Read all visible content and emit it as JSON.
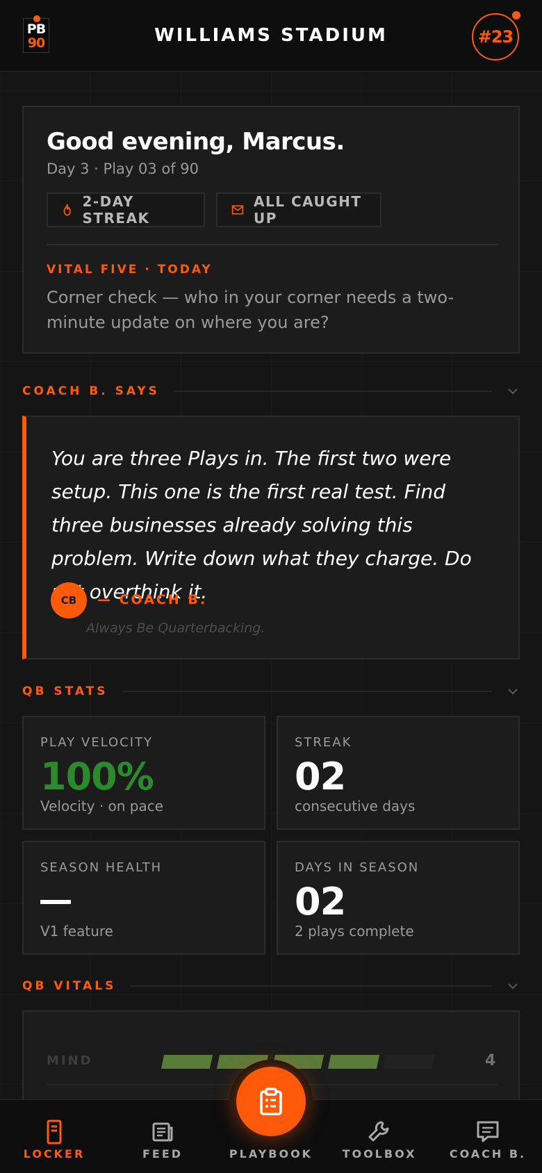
{
  "header": {
    "logo_top": "PB",
    "logo_bottom": "90",
    "title": "WILLIAMS STADIUM",
    "jersey": "#23"
  },
  "greeting": {
    "title": "Good evening, Marcus.",
    "subtitle": "Day 3 · Play 03 of 90",
    "chips": [
      {
        "icon": "flame-icon",
        "label": "2-DAY STREAK"
      },
      {
        "icon": "mail-icon",
        "label": "ALL CAUGHT UP"
      }
    ],
    "vital_label": "VITAL FIVE · TODAY",
    "vital_text": "Corner check — who in your corner needs a two-minute update on where you are?"
  },
  "coach": {
    "section_title": "COACH B. SAYS",
    "quote": "You are three Plays in. The first two were setup. This one is the first real test. Find three businesses already solving this problem. Write down what they charge. Do not overthink it.",
    "avatar_initials": "CB",
    "signature": "— COACH B.",
    "motto": "Always Be Quarterbacking."
  },
  "stats": {
    "section_title": "QB STATS",
    "items": [
      {
        "label": "PLAY VELOCITY",
        "value": "100%",
        "sub": "Velocity · on pace"
      },
      {
        "label": "STREAK",
        "value": "02",
        "sub": "consecutive days"
      },
      {
        "label": "SEASON HEALTH",
        "value": "—",
        "sub": "V1 feature"
      },
      {
        "label": "DAYS IN SEASON",
        "value": "02",
        "sub": "2 plays complete"
      }
    ]
  },
  "vitals": {
    "section_title": "QB VITALS",
    "rows": [
      {
        "label": "MIND",
        "level": 4,
        "max": 5,
        "value": "4"
      }
    ]
  },
  "colors": {
    "accent": "#ff5a0a",
    "positive": "#2b8a2b",
    "vital_bar": "#5a7a3a"
  },
  "nav": {
    "items": [
      {
        "label": "LOCKER",
        "icon": "phone-icon",
        "active": true
      },
      {
        "label": "FEED",
        "icon": "newspaper-icon",
        "active": false
      },
      {
        "label": "PLAYBOOK",
        "icon": "clipboard-icon",
        "active": false
      },
      {
        "label": "TOOLBOX",
        "icon": "wrench-icon",
        "active": false
      },
      {
        "label": "COACH B.",
        "icon": "chat-icon",
        "active": false
      }
    ]
  }
}
